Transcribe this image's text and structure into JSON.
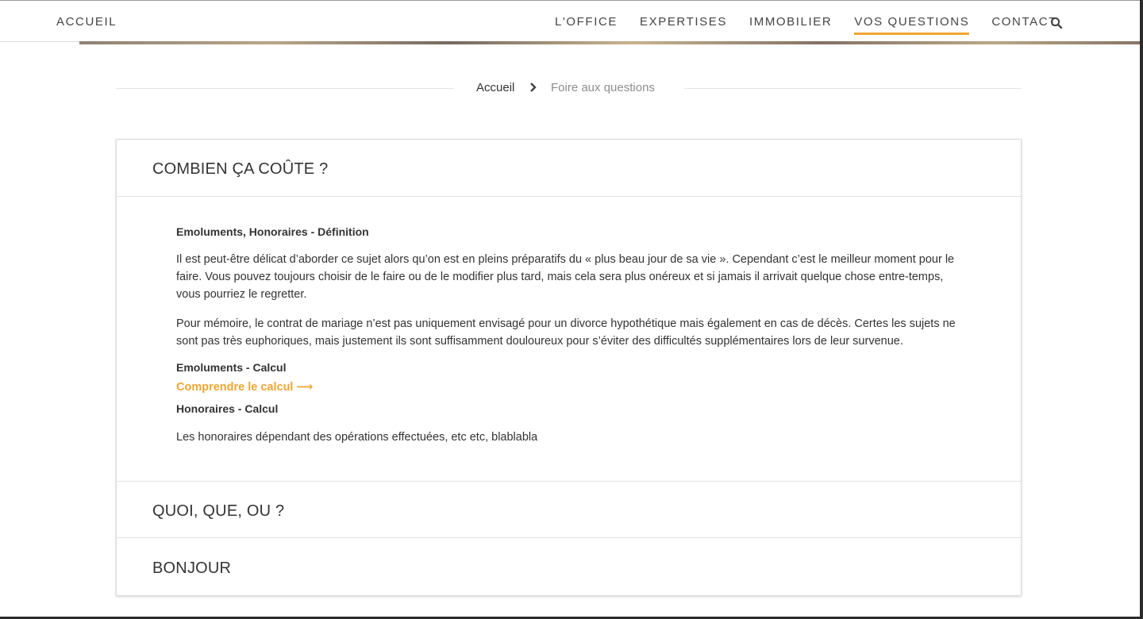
{
  "header": {
    "brand": "ACCUEIL",
    "nav": [
      {
        "label": "L'OFFICE"
      },
      {
        "label": "EXPERTISES"
      },
      {
        "label": "IMMOBILIER"
      },
      {
        "label": "VOS QUESTIONS",
        "active": true
      },
      {
        "label": "CONTACT"
      }
    ],
    "search_icon": "search-icon",
    "accent_color": "#f0a630"
  },
  "breadcrumb": {
    "home": "Accueil",
    "separator_icon": "chevron-right-icon",
    "current": "Foire aux questions"
  },
  "faq": {
    "sections": [
      {
        "title": "COMBIEN ÇA COÛTE ?",
        "expanded": true
      },
      {
        "title": "QUOI, QUE, OU ?",
        "expanded": false
      },
      {
        "title": "BONJOUR",
        "expanded": false
      }
    ],
    "content": {
      "heading_1": "Emoluments, Honoraires - Définition",
      "paragraph_1": "Il est peut-être délicat d’aborder ce sujet alors qu’on est en pleins préparatifs du « plus beau jour de sa vie ». Cependant c’est le meilleur moment pour le faire. Vous pouvez toujours choisir de le faire ou de le modifier plus tard, mais cela sera plus onéreux et si jamais il arrivait quelque chose entre-temps, vous pourriez le regretter.",
      "paragraph_2": "Pour mémoire, le contrat de mariage n’est pas uniquement envisagé pour un divorce hypothétique mais également en cas de décès. Certes les sujets ne sont pas très euphoriques, mais justement ils sont suffisamment douloureux pour s’éviter des difficultés supplémentaires lors de leur survenue.",
      "heading_2": "Emoluments - Calcul",
      "link": "Comprendre le calcul ⟶",
      "heading_3": "Honoraires - Calcul",
      "paragraph_3": "Les honoraires dépendant des opérations effectuées, etc etc, blablabla"
    }
  }
}
